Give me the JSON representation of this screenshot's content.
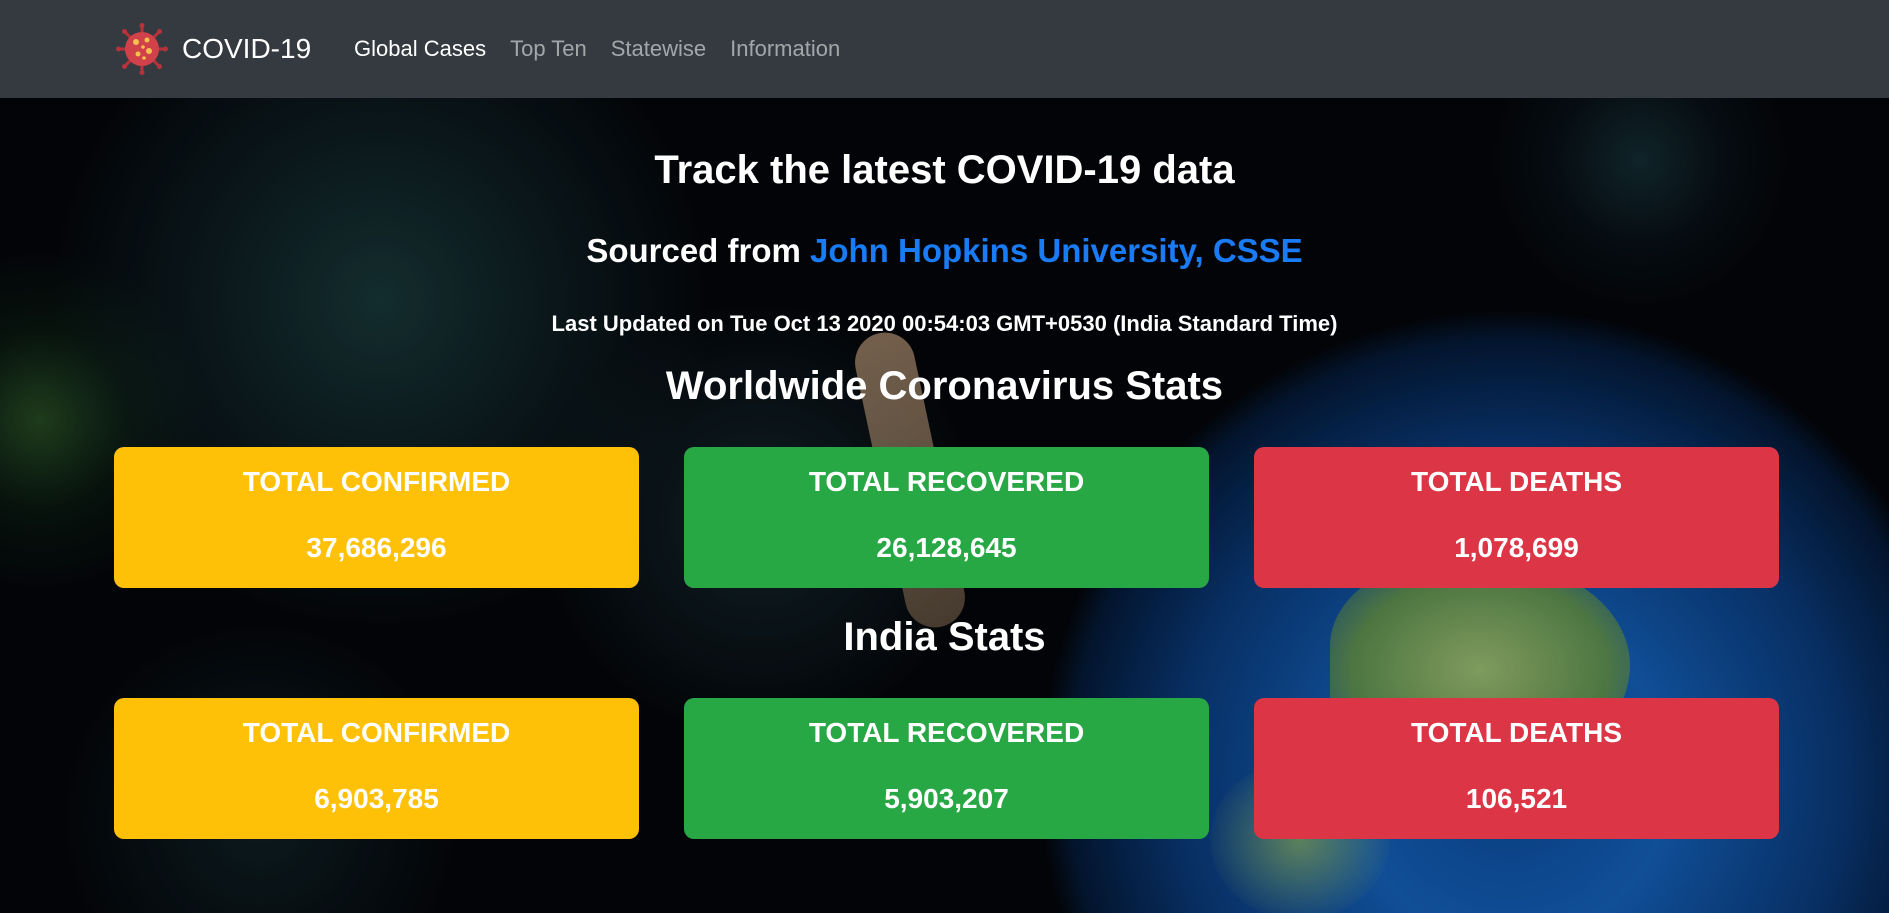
{
  "navbar": {
    "brand": "COVID-19",
    "brand_icon": "virus-icon",
    "links": [
      {
        "label": "Global Cases",
        "active": true
      },
      {
        "label": "Top Ten",
        "active": false
      },
      {
        "label": "Statewise",
        "active": false
      },
      {
        "label": "Information",
        "active": false
      }
    ]
  },
  "hero": {
    "headline": "Track the latest COVID-19 data",
    "sourced_prefix": "Sourced from ",
    "source_link": "John Hopkins University, CSSE",
    "last_updated": "Last Updated on Tue Oct 13 2020 00:54:03 GMT+0530 (India Standard Time)"
  },
  "worldwide": {
    "title": "Worldwide Coronavirus Stats",
    "cards": [
      {
        "label": "TOTAL CONFIRMED",
        "value": "37,686,296",
        "color": "#ffc107"
      },
      {
        "label": "TOTAL RECOVERED",
        "value": "26,128,645",
        "color": "#28a745"
      },
      {
        "label": "TOTAL DEATHS",
        "value": "1,078,699",
        "color": "#dc3545"
      }
    ]
  },
  "india": {
    "title": "India Stats",
    "cards": [
      {
        "label": "TOTAL CONFIRMED",
        "value": "6,903,785",
        "color": "#ffc107"
      },
      {
        "label": "TOTAL RECOVERED",
        "value": "5,903,207",
        "color": "#28a745"
      },
      {
        "label": "TOTAL DEATHS",
        "value": "106,521",
        "color": "#dc3545"
      }
    ]
  },
  "colors": {
    "navbar_bg": "#343a40",
    "link_blue": "#1a7cf5",
    "confirmed": "#ffc107",
    "recovered": "#28a745",
    "deaths": "#dc3545"
  }
}
